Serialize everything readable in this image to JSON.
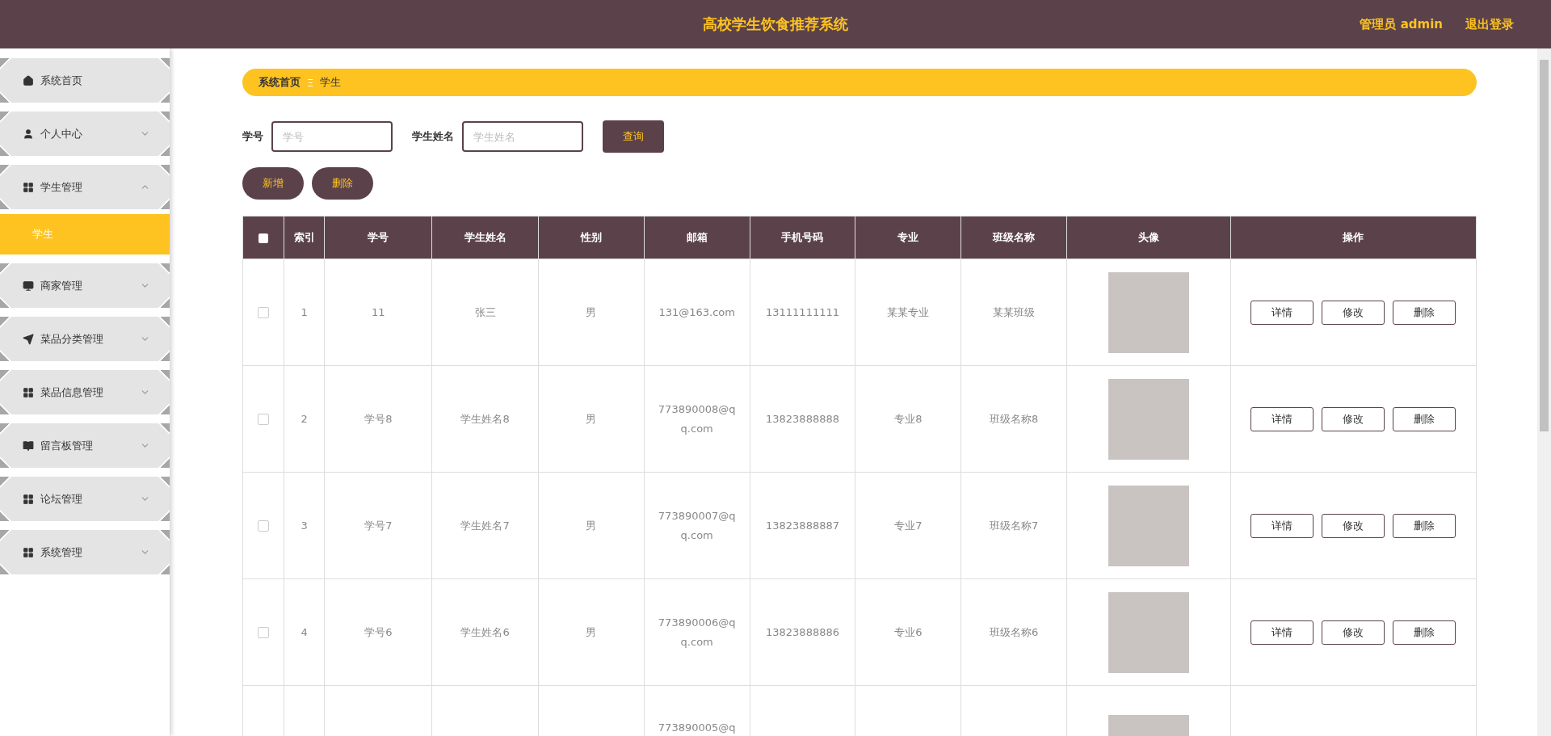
{
  "header": {
    "title": "高校学生饮食推荐系统",
    "user": "管理员 admin",
    "logout": "退出登录"
  },
  "sidebar": {
    "items": [
      {
        "label": "系统首页"
      },
      {
        "label": "个人中心",
        "expanded": false
      },
      {
        "label": "学生管理",
        "expanded": true,
        "children": [
          {
            "label": "学生",
            "selected": true
          }
        ]
      },
      {
        "label": "商家管理",
        "expanded": false
      },
      {
        "label": "菜品分类管理",
        "expanded": false
      },
      {
        "label": "菜品信息管理",
        "expanded": false
      },
      {
        "label": "留言板管理",
        "expanded": false
      },
      {
        "label": "论坛管理",
        "expanded": false
      },
      {
        "label": "系统管理",
        "expanded": false
      }
    ]
  },
  "breadcrumb": {
    "items": [
      "系统首页",
      "学生"
    ],
    "separator": "Ξ"
  },
  "search": {
    "fields": [
      {
        "label": "学号",
        "placeholder": "学号"
      },
      {
        "label": "学生姓名",
        "placeholder": "学生姓名"
      }
    ],
    "button": "查询"
  },
  "actions": [
    "新增",
    "删除"
  ],
  "table": {
    "header_checked": false,
    "columns": [
      "索引",
      "学号",
      "学生姓名",
      "性别",
      "邮箱",
      "手机号码",
      "专业",
      "班级名称",
      "头像",
      "操作"
    ],
    "rows": [
      {
        "checked": false,
        "index": "1",
        "id": "11",
        "name": "张三",
        "gender": "男",
        "email": "131@163.com",
        "phone": "13111111111",
        "major": "某某专业",
        "class": "某某班级",
        "buttons": [
          "详情",
          "修改",
          "删除"
        ]
      },
      {
        "checked": false,
        "index": "2",
        "id": "学号8",
        "name": "学生姓名8",
        "gender": "男",
        "email": "773890008@qq.com",
        "phone": "13823888888",
        "major": "专业8",
        "class": "班级名称8",
        "buttons": [
          "详情",
          "修改",
          "删除"
        ]
      },
      {
        "checked": false,
        "index": "3",
        "id": "学号7",
        "name": "学生姓名7",
        "gender": "男",
        "email": "773890007@qq.com",
        "phone": "13823888887",
        "major": "专业7",
        "class": "班级名称7",
        "buttons": [
          "详情",
          "修改",
          "删除"
        ]
      },
      {
        "checked": false,
        "index": "4",
        "id": "学号6",
        "name": "学生姓名6",
        "gender": "男",
        "email": "773890006@qq.com",
        "phone": "13823888886",
        "major": "专业6",
        "class": "班级名称6",
        "buttons": [
          "详情",
          "修改",
          "删除"
        ]
      },
      {
        "email": "773890005@q",
        "buttons": []
      }
    ]
  }
}
